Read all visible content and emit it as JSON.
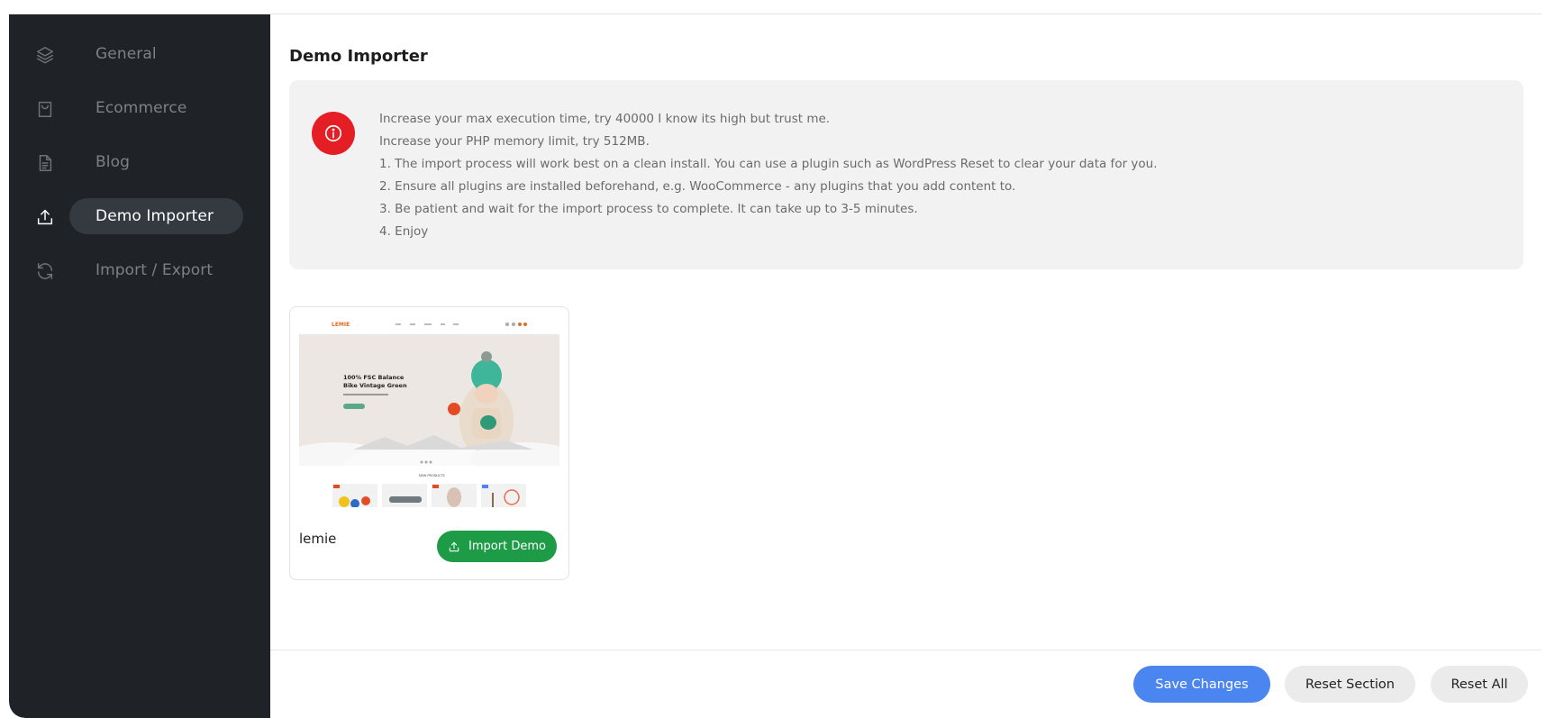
{
  "sidebar": {
    "items": [
      {
        "label": "General",
        "icon": "layers-icon"
      },
      {
        "label": "Ecommerce",
        "icon": "shopping-bag-icon"
      },
      {
        "label": "Blog",
        "icon": "document-icon"
      },
      {
        "label": "Demo Importer",
        "icon": "upload-icon",
        "active": true
      },
      {
        "label": "Import / Export",
        "icon": "refresh-icon"
      }
    ]
  },
  "main": {
    "title": "Demo Importer",
    "notice": {
      "icon": "info-alert-icon",
      "icon_color": "#e51d24",
      "lines": [
        "Increase your max execution time, try 40000 I know its high but trust me.",
        "Increase your PHP memory limit, try 512MB.",
        "1. The import process will work best on a clean install. You can use a plugin such as WordPress Reset to clear your data for you.",
        "2. Ensure all plugins are installed beforehand, e.g. WooCommerce - any plugins that you add content to.",
        "3. Be patient and wait for the import process to complete. It can take up to 3-5 minutes.",
        "4. Enjoy"
      ]
    },
    "demo": {
      "name": "lemie",
      "button_label": "Import Demo",
      "button_color": "#1d9b47",
      "preview": {
        "logo": "LEMIE",
        "hero_title_1": "100% FSC Balance",
        "hero_title_2": "Bike Vintage Green",
        "section_label": "NEW PRODUCTS"
      }
    }
  },
  "footer": {
    "save_label": "Save Changes",
    "save_color": "#4a85f0",
    "reset_section_label": "Reset Section",
    "reset_all_label": "Reset All"
  }
}
